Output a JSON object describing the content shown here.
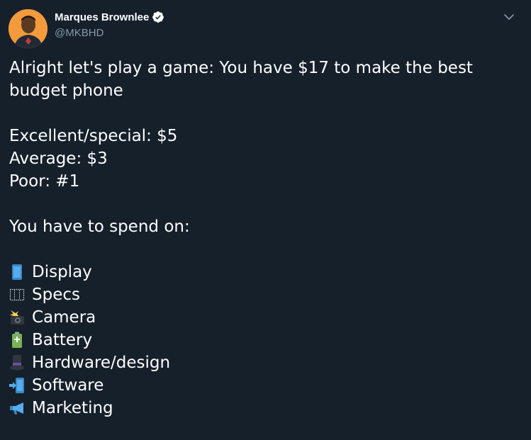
{
  "tweet": {
    "author": {
      "name": "Marques Brownlee",
      "handle": "@MKBHD",
      "avatar_icon": "avatar-photo",
      "verified_icon": "verified-badge-icon"
    },
    "menu_icon": "chevron-down-icon",
    "text": {
      "intro": "Alright let's play a game: You have $17 to make the best budget phone",
      "tiers": [
        "Excellent/special: $5",
        "Average: $3",
        "Poor: #1"
      ],
      "prompt": "You have to spend on:",
      "items": [
        {
          "icon": "mobile-phone-emoji",
          "label": "Display"
        },
        {
          "icon": "abacus-emoji",
          "label": "Specs"
        },
        {
          "icon": "camera-flash-emoji",
          "label": "Camera"
        },
        {
          "icon": "battery-emoji",
          "label": "Battery"
        },
        {
          "icon": "top-hat-emoji",
          "label": "Hardware/design"
        },
        {
          "icon": "mobile-arrow-emoji",
          "label": "Software"
        },
        {
          "icon": "megaphone-emoji",
          "label": "Marketing"
        }
      ]
    }
  },
  "colors": {
    "background": "#15202b",
    "text": "#ffffff",
    "secondary_text": "#8899a6",
    "verified": "#ffffff",
    "accent_blue": "#1da1f2"
  }
}
